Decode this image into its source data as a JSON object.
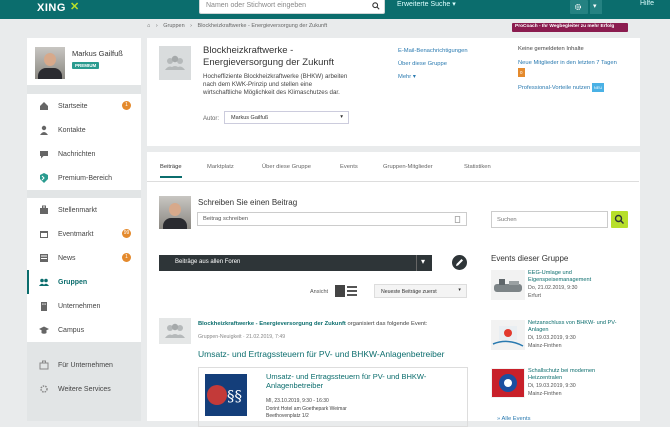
{
  "header": {
    "logo": "XING",
    "search_placeholder": "Namen oder Stichwort eingeben",
    "advanced_search": "Erweiterte Suche",
    "help": "Hilfe"
  },
  "breadcrumb": {
    "items": [
      "Gruppen",
      "Blockheizkraftwerke - Energieversorgung der Zukunft"
    ]
  },
  "procoach": "ProCoach - Ihr Wegbegleiter zu mehr Erfolg",
  "profile": {
    "name": "Markus Gailfuß",
    "badge": "PREMIUM"
  },
  "sidebar": {
    "items": [
      {
        "label": "Startseite",
        "icon": "home-icon",
        "badge": "1"
      },
      {
        "label": "Kontakte",
        "icon": "contacts-icon",
        "badge": ""
      },
      {
        "label": "Nachrichten",
        "icon": "messages-icon",
        "badge": ""
      },
      {
        "label": "Premium-Bereich",
        "icon": "premium-icon",
        "badge": ""
      },
      {
        "label": "Stellenmarkt",
        "icon": "jobs-icon",
        "badge": ""
      },
      {
        "label": "Eventmarkt",
        "icon": "events-icon",
        "badge": "99"
      },
      {
        "label": "News",
        "icon": "news-icon",
        "badge": "1"
      },
      {
        "label": "Gruppen",
        "icon": "groups-icon",
        "badge": ""
      },
      {
        "label": "Unternehmen",
        "icon": "companies-icon",
        "badge": ""
      },
      {
        "label": "Campus",
        "icon": "campus-icon",
        "badge": ""
      },
      {
        "label": "Für Unternehmen",
        "icon": "business-icon",
        "badge": ""
      },
      {
        "label": "Weitere Services",
        "icon": "services-icon",
        "badge": ""
      }
    ]
  },
  "group": {
    "title": "Blockheizkraftwerke - Energieversorgung der Zukunft",
    "description": "Hocheffiziente Blockheizkraftwerke (BHKW) arbeiten nach dem KWK-Prinzip und stellen eine wirtschaftliche Möglichkeit des Klimaschutzes dar.",
    "author_label": "Autor:",
    "author": "Markus Gailfuß",
    "links": [
      "E-Mail-Benachrichtigungen",
      "Über diese Gruppe",
      "Mehr"
    ],
    "right": {
      "no_content": "Keine gemeldeten Inhalte",
      "new_members": "Neue Mitglieder in den letzten 7 Tagen",
      "new_members_count": "0",
      "pro_benefits": "Professional-Vorteile nutzen",
      "pro_badge": "NEU"
    }
  },
  "tabs": [
    "Beiträge",
    "Marktplatz",
    "Über diese Gruppe",
    "Events",
    "Gruppen-Mitglieder",
    "Statistiken"
  ],
  "composer": {
    "title": "Schreiben Sie einen Beitrag",
    "placeholder": "Beitrag schreiben"
  },
  "filter": {
    "label": "Beiträge aus allen Foren",
    "view_label": "Ansicht",
    "sort": "Neueste Beiträge zuerst"
  },
  "post": {
    "group": "Blockheizkraftwerke - Energieversorgung der Zukunft",
    "action": " organisiert das folgende Event:",
    "subline": "Gruppen-Neuigkeit · 21.02.2019, 7:49",
    "title": "Umsatz- und Ertragssteuern für PV- und BHKW-Anlagenbetreiber",
    "event": {
      "title": "Umsatz- und Ertragssteuern für PV- und BHKW-Anlagenbetreiber",
      "date": "MI, 23.10.2019, 9:30 - 16:30",
      "venue": "Dorint Hotel am Goethepark Weimar",
      "street": "Beethovenplatz 1/2"
    }
  },
  "right_search": {
    "placeholder": "Suchen"
  },
  "events": {
    "heading": "Events dieser Gruppe",
    "items": [
      {
        "title": "EEG-Umlage und Eigenspeisemanagement",
        "date": "Do, 21.02.2019, 9:30",
        "place": "Erfurt"
      },
      {
        "title": "Netzanschluss von BHKW- und PV-Anlagen",
        "date": "Di, 19.03.2019, 9:30",
        "place": "Mainz-Finthen"
      },
      {
        "title": "Schallschutz bei modernen Heizzentralen",
        "date": "Di, 19.03.2019, 9:30",
        "place": "Mainz-Finthen"
      }
    ],
    "all_link": "» Alle Events"
  }
}
